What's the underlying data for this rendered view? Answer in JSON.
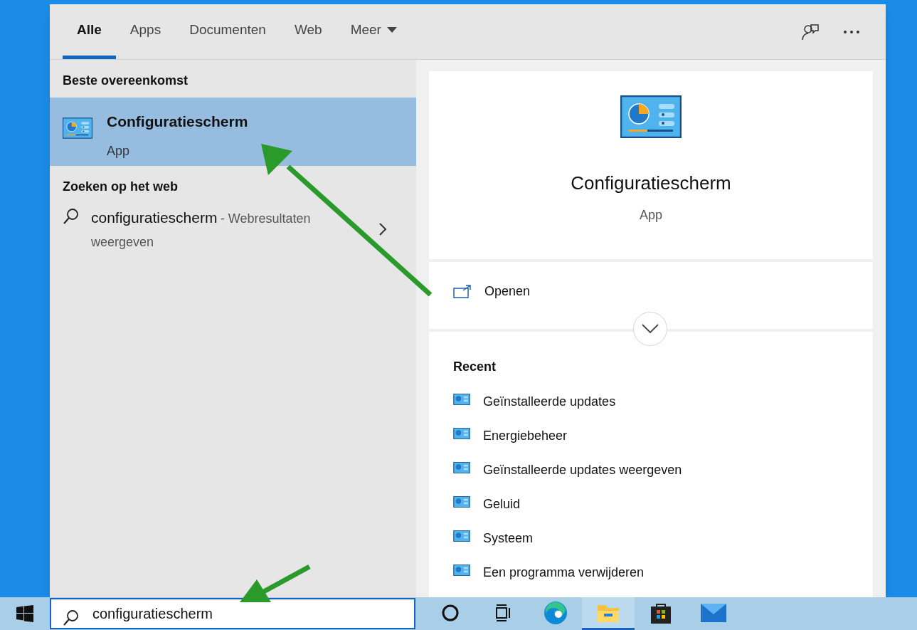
{
  "tabs": [
    {
      "label": "Alle",
      "selected": true
    },
    {
      "label": "Apps",
      "selected": false
    },
    {
      "label": "Documenten",
      "selected": false
    },
    {
      "label": "Web",
      "selected": false
    },
    {
      "label": "Meer",
      "selected": false,
      "kind": "dropdown"
    }
  ],
  "best_match": {
    "heading": "Beste overeenkomst",
    "title": "Configuratiescherm",
    "subtitle": "App",
    "selected": true
  },
  "web": {
    "heading": "Zoeken op het web",
    "query": "configuratiescherm",
    "suffix": "- Webresultaten weergeven"
  },
  "detail": {
    "title": "Configuratiescherm",
    "subtitle": "App",
    "action": "Openen",
    "recent_heading": "Recent",
    "recent": [
      "Geïnstalleerde updates",
      "Energiebeheer",
      "Geïnstalleerde updates weergeven",
      "Geluid",
      "Systeem",
      "Een programma verwijderen"
    ]
  },
  "search": {
    "value": "configuratiescherm"
  },
  "taskbar": [
    {
      "kind": "cortana",
      "running": false
    },
    {
      "kind": "taskview",
      "running": false
    },
    {
      "kind": "edge",
      "running": false
    },
    {
      "kind": "explorer",
      "running": true
    },
    {
      "kind": "store",
      "running": false
    },
    {
      "kind": "mail",
      "running": false
    }
  ]
}
